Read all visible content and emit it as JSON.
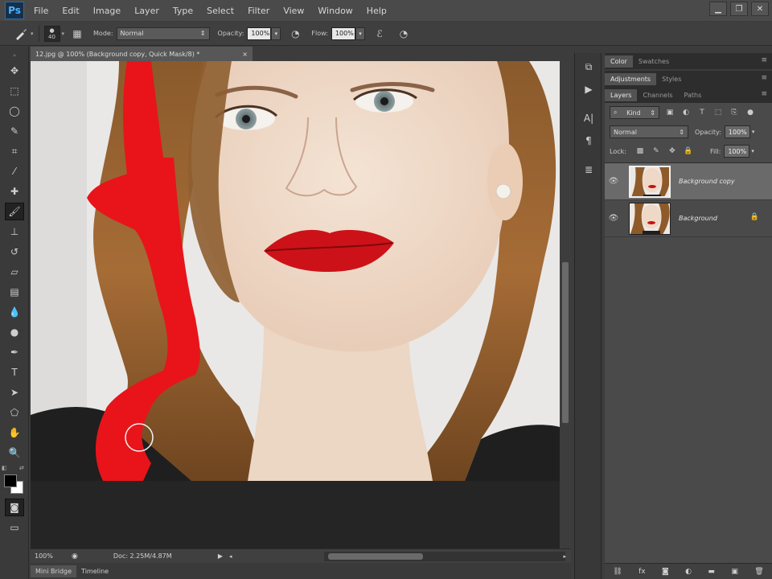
{
  "app": {
    "logo": "Ps"
  },
  "menu": [
    "File",
    "Edit",
    "Image",
    "Layer",
    "Type",
    "Select",
    "Filter",
    "View",
    "Window",
    "Help"
  ],
  "options": {
    "brush_size": "40",
    "mode_label": "Mode:",
    "mode_value": "Normal",
    "opacity_label": "Opacity:",
    "opacity_value": "100%",
    "flow_label": "Flow:",
    "flow_value": "100%"
  },
  "document": {
    "tab_title": "12.jpg @ 100% (Background copy, Quick Mask/8) *",
    "zoom": "100%",
    "doc_info": "Doc: 2.25M/4.87M"
  },
  "bottom_tabs": [
    "Mini Bridge",
    "Timeline"
  ],
  "panels": {
    "group1": [
      "Color",
      "Swatches"
    ],
    "group2": [
      "Adjustments",
      "Styles"
    ],
    "group3": [
      "Layers",
      "Channels",
      "Paths"
    ]
  },
  "layers_panel": {
    "filter_value": "Kind",
    "blend_mode": "Normal",
    "opacity_label": "Opacity:",
    "opacity_value": "100%",
    "lock_label": "Lock:",
    "fill_label": "Fill:",
    "fill_value": "100%",
    "layers": [
      {
        "name": "Background copy"
      },
      {
        "name": "Background"
      }
    ]
  },
  "colors": {
    "mask_red": "#e8141a",
    "ui_dark": "#3c3c3c",
    "accent": "#4fb1ff"
  }
}
